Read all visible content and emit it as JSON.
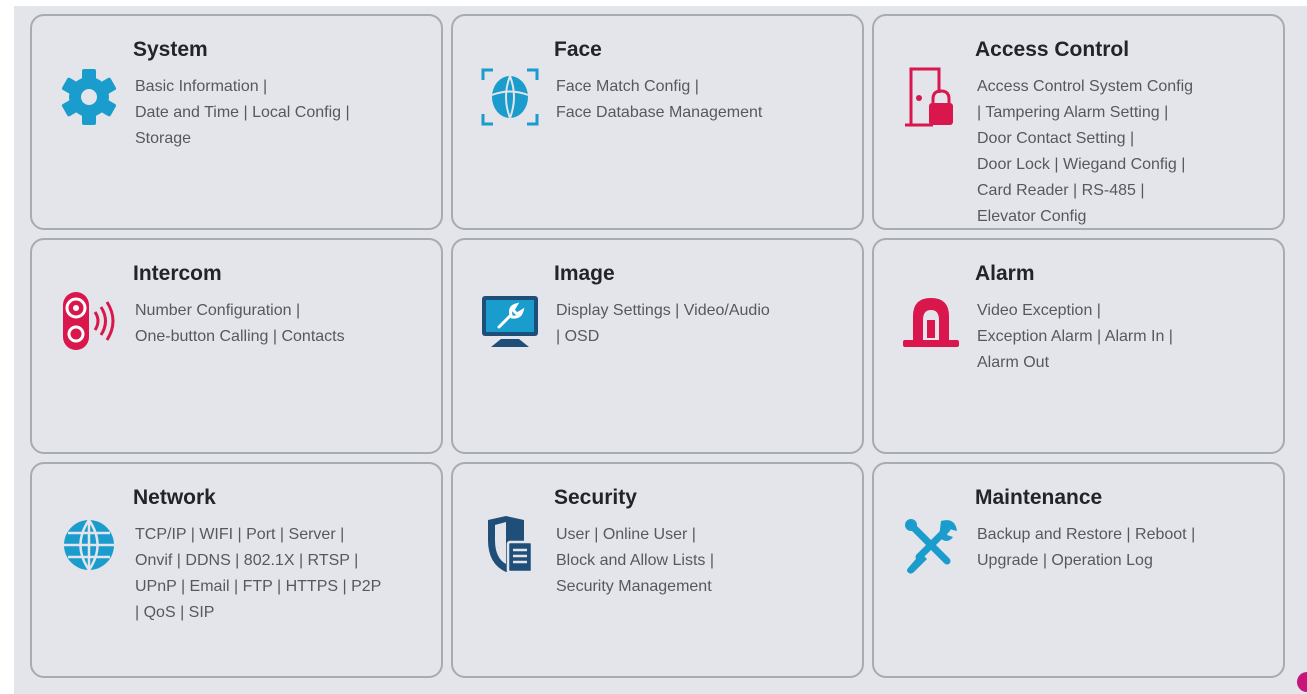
{
  "colors": {
    "blue": "#1a9ccc",
    "red": "#d9174d",
    "navy": "#1f4e79",
    "background": "#e3e5ea",
    "border": "#a7abb2"
  },
  "cards": [
    {
      "title": "System",
      "icon": "gear-icon",
      "lines": [
        [
          "Basic Information |"
        ],
        [
          "Date and Time |",
          " Local Config |"
        ],
        [
          "Storage"
        ]
      ]
    },
    {
      "title": "Face",
      "icon": "face-scan-icon",
      "lines": [
        [
          "Face Match Config |"
        ],
        [
          "Face Database Management"
        ]
      ]
    },
    {
      "title": "Access Control",
      "icon": "door-lock-icon",
      "lines": [
        [
          "Access Control System Config"
        ],
        [
          " | Tampering Alarm Setting |"
        ],
        [
          "Door Contact Setting |"
        ],
        [
          "Door Lock |",
          " Wiegand Config |"
        ],
        [
          "Card Reader |",
          " RS-485 |"
        ],
        [
          "Elevator Config"
        ]
      ]
    },
    {
      "title": "Intercom",
      "icon": "intercom-icon",
      "lines": [
        [
          "Number Configuration |"
        ],
        [
          "One-button Calling ",
          " | Contacts"
        ]
      ]
    },
    {
      "title": "Image",
      "icon": "monitor-wrench-icon",
      "lines": [
        [
          "Display Settings |",
          " Video/Audio"
        ],
        [
          " | OSD"
        ]
      ]
    },
    {
      "title": "Alarm",
      "icon": "alarm-siren-icon",
      "lines": [
        [
          "Video Exception |"
        ],
        [
          "Exception Alarm |",
          " Alarm In |"
        ],
        [
          "Alarm Out"
        ]
      ]
    },
    {
      "title": "Network",
      "icon": "globe-icon",
      "lines": [
        [
          "TCP/IP |",
          " WIFI |",
          " Port |",
          " Server |"
        ],
        [
          "Onvif |",
          " DDNS |",
          " 802.1X |",
          " RTSP |"
        ],
        [
          "UPnP |",
          " Email |",
          " FTP |",
          " HTTPS |",
          " P2P"
        ],
        [
          " | QoS",
          " | SIP"
        ]
      ]
    },
    {
      "title": "Security",
      "icon": "shield-document-icon",
      "lines": [
        [
          "User |",
          " Online User |"
        ],
        [
          "Block and Allow Lists |"
        ],
        [
          "Security Management"
        ]
      ]
    },
    {
      "title": "Maintenance",
      "icon": "tools-icon",
      "lines": [
        [
          "Backup and Restore ",
          " | Reboot |"
        ],
        [
          "Upgrade |",
          " Operation Log"
        ]
      ]
    }
  ]
}
